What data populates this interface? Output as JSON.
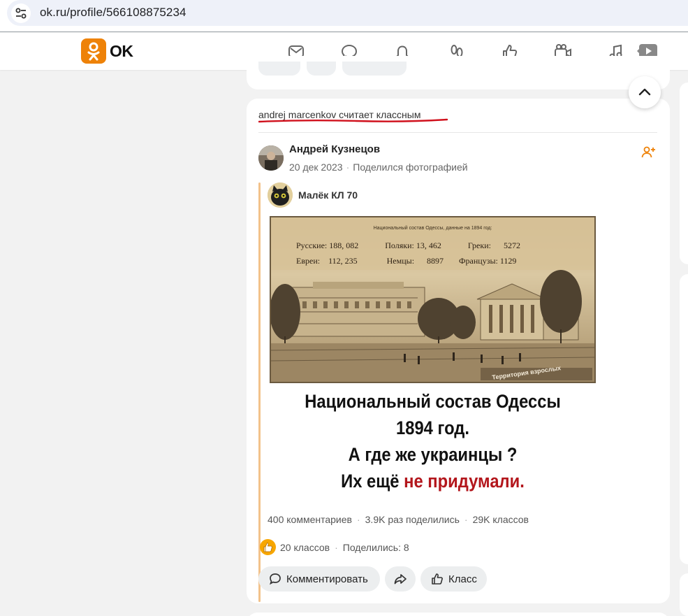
{
  "browser": {
    "url": "ok.ru/profile/566108875234"
  },
  "header": {
    "logo_text": "OK",
    "brand_color": "#ee8208",
    "nav_icons": [
      "messages-icon",
      "discussions-icon",
      "notifications-icon",
      "guests-icon",
      "events-icon",
      "video-icon",
      "music-icon",
      "video-play-icon"
    ]
  },
  "post": {
    "activity": "andrej marcenkov считает классным",
    "author": "Андрей Кузнецов",
    "date": "20 дек 2023",
    "action": "Поделился фотографией",
    "repost": {
      "author": "Малёк КЛ 70",
      "image": {
        "title": "Национальный состав Одессы, данные на 1894 год:",
        "row1": [
          "Русские: 188, 082",
          "Поляки: 13, 462",
          "Греки:",
          "5272"
        ],
        "row2": [
          "Евреи:",
          "112, 235",
          "Немцы:",
          "8897",
          "Французы: 1129"
        ],
        "watermark": "Территория взрослых"
      },
      "poster": {
        "line1": "Национальный состав Одессы",
        "line2": "1894 год.",
        "line3": "А где же украинцы ?",
        "line4_black": "Их ещё",
        "line4_red": "не придумали."
      },
      "stats": {
        "comments": "400 комментариев",
        "shares": "3.9K раз поделились",
        "likes": "29K классов"
      }
    },
    "likes": "20 классов",
    "shares": "Поделились: 8",
    "buttons": {
      "comment": "Комментировать",
      "like": "Класс"
    }
  }
}
